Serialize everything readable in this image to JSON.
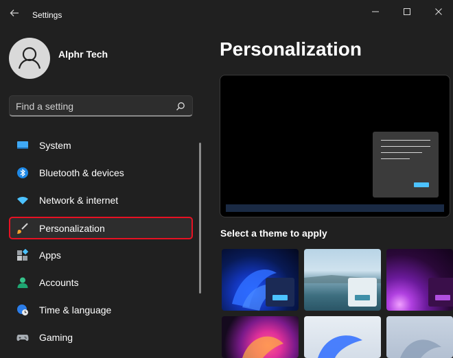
{
  "window": {
    "title": "Settings",
    "back_icon": "back-arrow-icon",
    "minimize_glyph": "—",
    "maximize_glyph": "☐",
    "close_glyph": "✕"
  },
  "profile": {
    "name": "Alphr Tech",
    "icon": "user-avatar-icon"
  },
  "search": {
    "placeholder": "Find a setting",
    "value": ""
  },
  "sidebar": {
    "items": [
      {
        "label": "System",
        "icon": "system-icon"
      },
      {
        "label": "Bluetooth & devices",
        "icon": "bluetooth-icon"
      },
      {
        "label": "Network & internet",
        "icon": "wifi-icon"
      },
      {
        "label": "Personalization",
        "icon": "brush-icon",
        "selected": true
      },
      {
        "label": "Apps",
        "icon": "apps-icon"
      },
      {
        "label": "Accounts",
        "icon": "person-icon"
      },
      {
        "label": "Time & language",
        "icon": "globe-clock-icon"
      },
      {
        "label": "Gaming",
        "icon": "gamepad-icon"
      }
    ]
  },
  "main": {
    "title": "Personalization",
    "themes_heading": "Select a theme to apply"
  },
  "colors": {
    "background": "#202020",
    "accent": "#4cc2ff",
    "selection_outline": "#e81123"
  }
}
